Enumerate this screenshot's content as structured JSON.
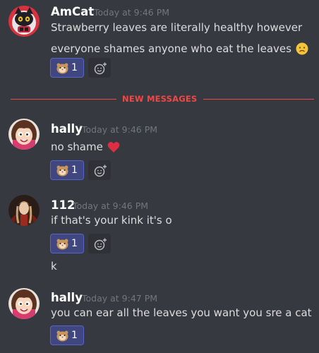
{
  "colors": {
    "background": "#36393f",
    "new_messages": "#f04747",
    "reaction_bg": "#3f4680",
    "reaction_border": "#5865c8",
    "timestamp": "#72767d"
  },
  "divider": {
    "label": "NEW MESSAGES"
  },
  "messages": [
    {
      "author": "AmCat",
      "timestamp": "Today at 9:46 PM",
      "avatar_icon": "black-cat-avatar",
      "lines": [
        "Strawberry leaves are literally healthy however",
        "everyone shames anyone who eat the leaves"
      ],
      "trailing_emoji": "worried-face",
      "reaction": {
        "emoji": "hamster-face",
        "count": "1"
      }
    },
    {
      "author": "hally",
      "timestamp": "Today at 9:46 PM",
      "avatar_icon": "cartoon-girl-avatar",
      "lines": [
        "no shame"
      ],
      "trailing_emoji": "red-heart",
      "reaction": {
        "emoji": "hamster-face",
        "count": "1"
      }
    },
    {
      "author": "112",
      "timestamp": "Today at 9:46 PM",
      "avatar_icon": "portrait-avatar",
      "lines": [
        "if that's your kink it's o"
      ],
      "reaction": {
        "emoji": "hamster-face",
        "count": "1"
      },
      "followup": "k"
    },
    {
      "author": "hally",
      "timestamp": "Today at 9:47 PM",
      "avatar_icon": "cartoon-girl-avatar",
      "lines": [
        "you can ear all the leaves you want you sre a cat"
      ],
      "reaction": {
        "emoji": "hamster-face",
        "count": "1"
      }
    }
  ]
}
